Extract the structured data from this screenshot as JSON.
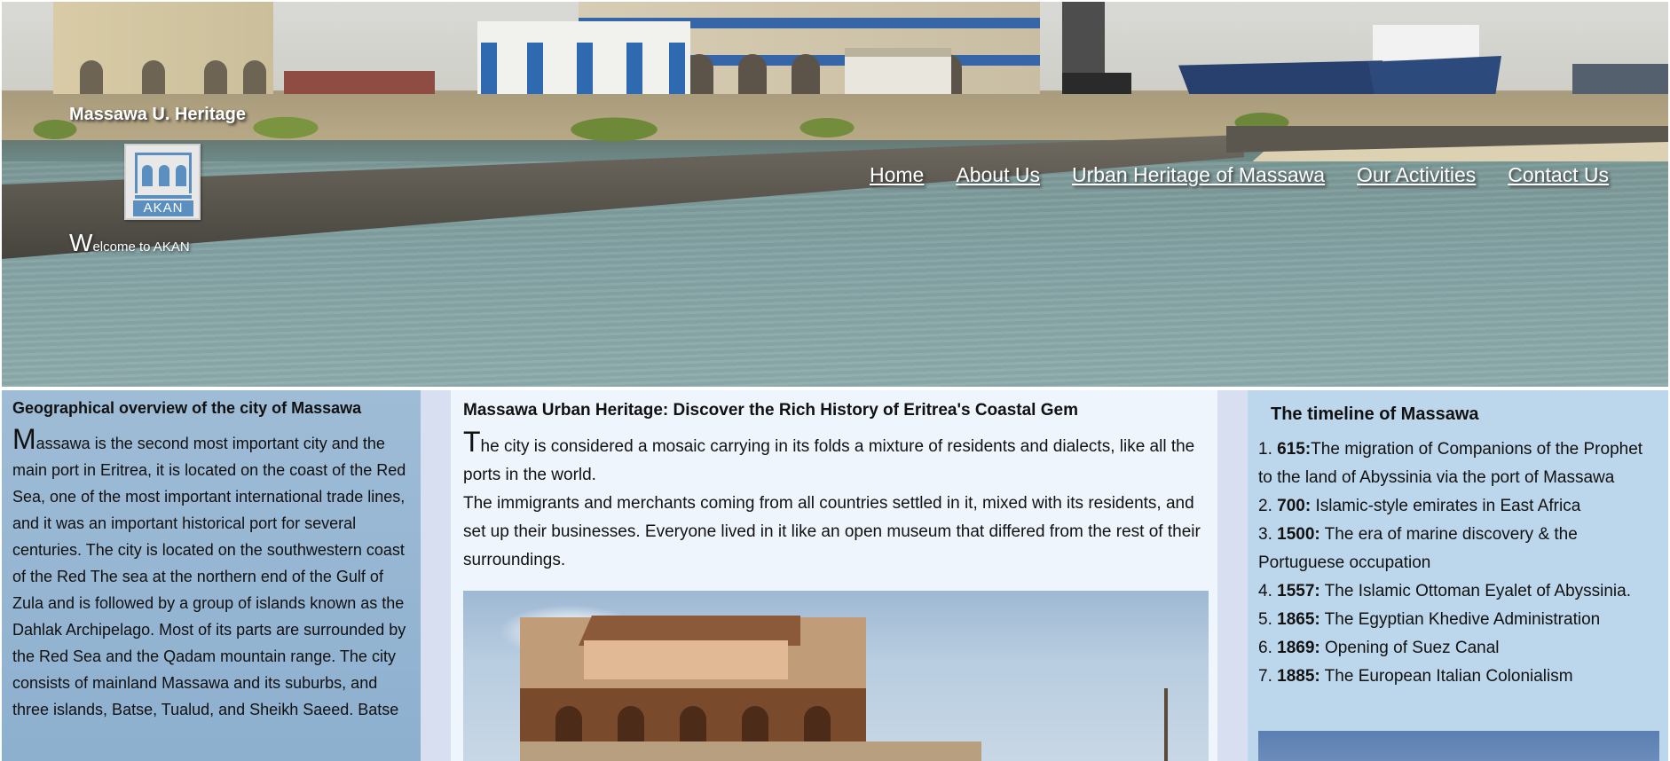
{
  "header": {
    "site_title": "Massawa U. Heritage",
    "logo_text": "AKAN",
    "welcome_cap": "W",
    "welcome_rest": "elcome to AKAN",
    "nav": [
      {
        "label": "Home"
      },
      {
        "label": "About Us"
      },
      {
        "label": "Urban Heritage of Massawa"
      },
      {
        "label": "Our Activities"
      },
      {
        "label": "Contact Us"
      }
    ]
  },
  "left": {
    "title": "Geographical overview of the city of Massawa",
    "dropcap": "M",
    "body": "assawa is the second most important city and the main port in Eritrea, it is located on the coast of the Red Sea, one of the most important international trade lines, and it was an important historical port for several centuries. The city is located on the southwestern coast of the Red The sea at the northern end of the Gulf of Zula and is followed by a group of islands known as the Dahlak Archipelago. Most of its parts are surrounded by the Red Sea and the Qadam mountain range. The city consists of mainland Massawa and its suburbs, and three islands, Batse, Tualud, and Sheikh Saeed. Batse"
  },
  "middle": {
    "title": "Massawa Urban Heritage: Discover the Rich History of Eritrea's Coastal Gem",
    "dropcap": "T",
    "para1": "he city is considered a mosaic carrying in its folds a mixture of residents and dialects, like all the ports in the world.",
    "para2": "The immigrants and merchants coming from all countries settled in it, mixed with its residents, and set up their businesses. Everyone lived in it like an open museum that differed from the rest of their surroundings."
  },
  "right": {
    "title": "The timeline of Massawa",
    "items": [
      {
        "num": "1.",
        "year": "615:",
        "text": "The migration of Companions of the Prophet to the land of Abyssinia via the port of Massawa"
      },
      {
        "num": "2.",
        "year": "700:",
        "text": " Islamic-style emirates in East Africa"
      },
      {
        "num": "3.",
        "year": "1500:",
        "text": " The era of marine discovery & the Portuguese occupation"
      },
      {
        "num": "4.",
        "year": "1557:",
        "text": " The Islamic Ottoman Eyalet of Abyssinia."
      },
      {
        "num": "5.",
        "year": "1865:",
        "text": " The Egyptian Khedive Administration"
      },
      {
        "num": "6.",
        "year": "1869:",
        "text": " Opening of Suez Canal"
      },
      {
        "num": "7.",
        "year": "1885:",
        "text": " The European Italian Colonialism"
      }
    ]
  },
  "colors": {
    "left_panel": "#9fbcd6",
    "middle_panel": "#eef5fc",
    "right_panel": "#bcd6ec",
    "logo_blue": "#5b8fbf"
  }
}
